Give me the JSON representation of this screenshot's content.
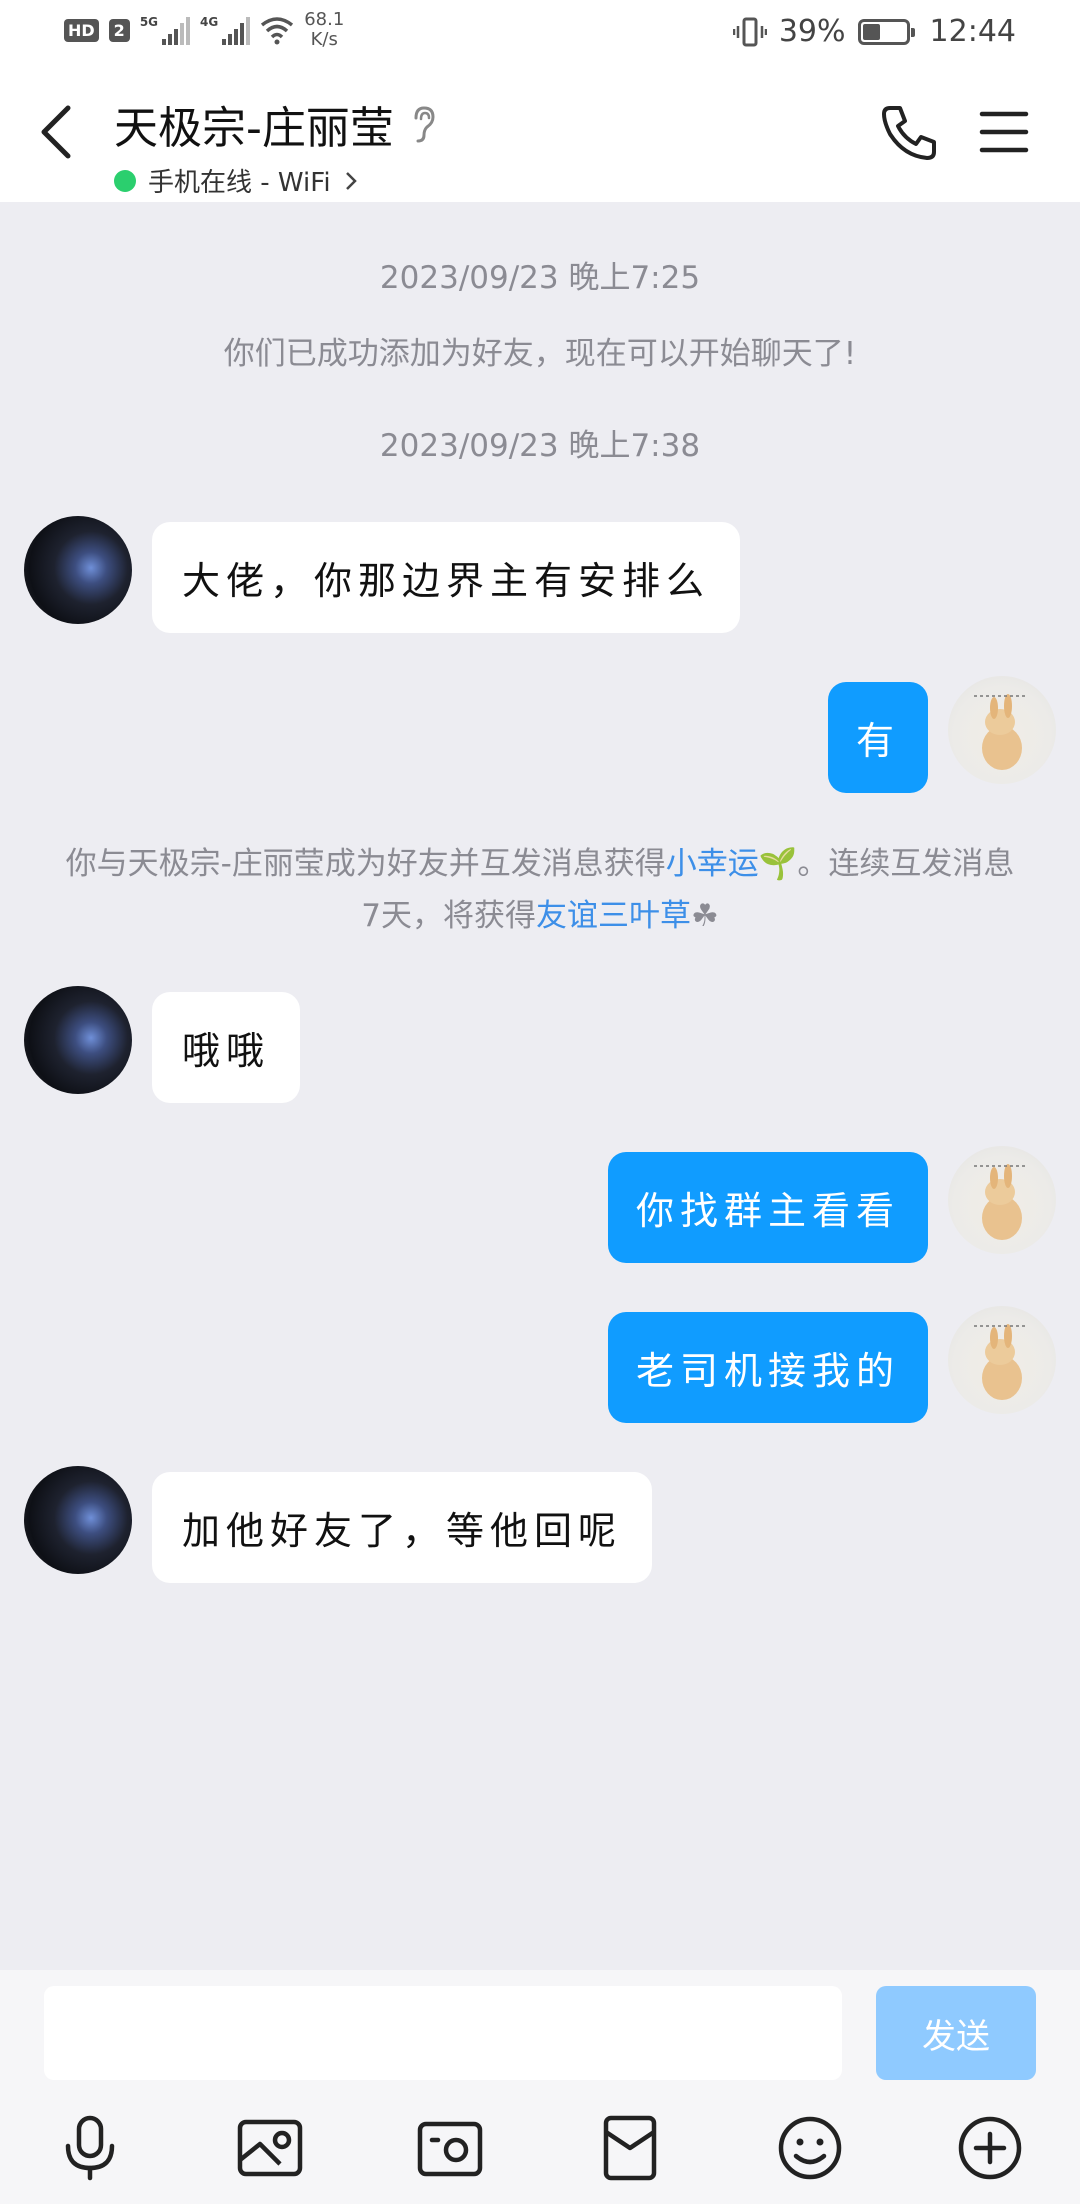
{
  "status_bar": {
    "hd_label": "HD",
    "sim_label": "2",
    "net1_label": "5G",
    "net2_label": "4G",
    "speed_value": "68.1",
    "speed_unit": "K/s",
    "battery_percent": "39%",
    "time": "12:44",
    "battery_level": 0.39
  },
  "header": {
    "title": "天极宗-庄丽莹",
    "status": "手机在线 - WiFi",
    "online_color": "#2bcf6e"
  },
  "chat": {
    "timestamp1": "2023/09/23 晚上7:25",
    "friend_added": "你们已成功添加为好友，现在可以开始聊天了!",
    "timestamp2": "2023/09/23 晚上7:38",
    "messages": [
      {
        "side": "left",
        "text": "大佬，你那边界主有安排么"
      },
      {
        "side": "right",
        "text": "有"
      },
      {
        "side": "left",
        "text": "哦哦"
      },
      {
        "side": "right",
        "text": "你找群主看看"
      },
      {
        "side": "right",
        "text": "老司机接我的"
      },
      {
        "side": "left",
        "text": "加他好友了，等他回呢"
      }
    ],
    "system_msg": {
      "part1": "你与天极宗-庄丽莹成为好友并互发消息获得",
      "link1": "小幸运",
      "part2": "。连续互发消息7天，将获得",
      "link2": "友谊三叶草"
    }
  },
  "input": {
    "placeholder": "",
    "send_label": "发送"
  },
  "toolbar": {
    "icons": [
      "microphone-icon",
      "image-icon",
      "camera-icon",
      "red-packet-icon",
      "emoji-icon",
      "plus-icon"
    ]
  },
  "colors": {
    "accent": "#109cff",
    "send_disabled": "#8fcaff",
    "link": "#3d8fe8",
    "background": "#ededf2"
  }
}
